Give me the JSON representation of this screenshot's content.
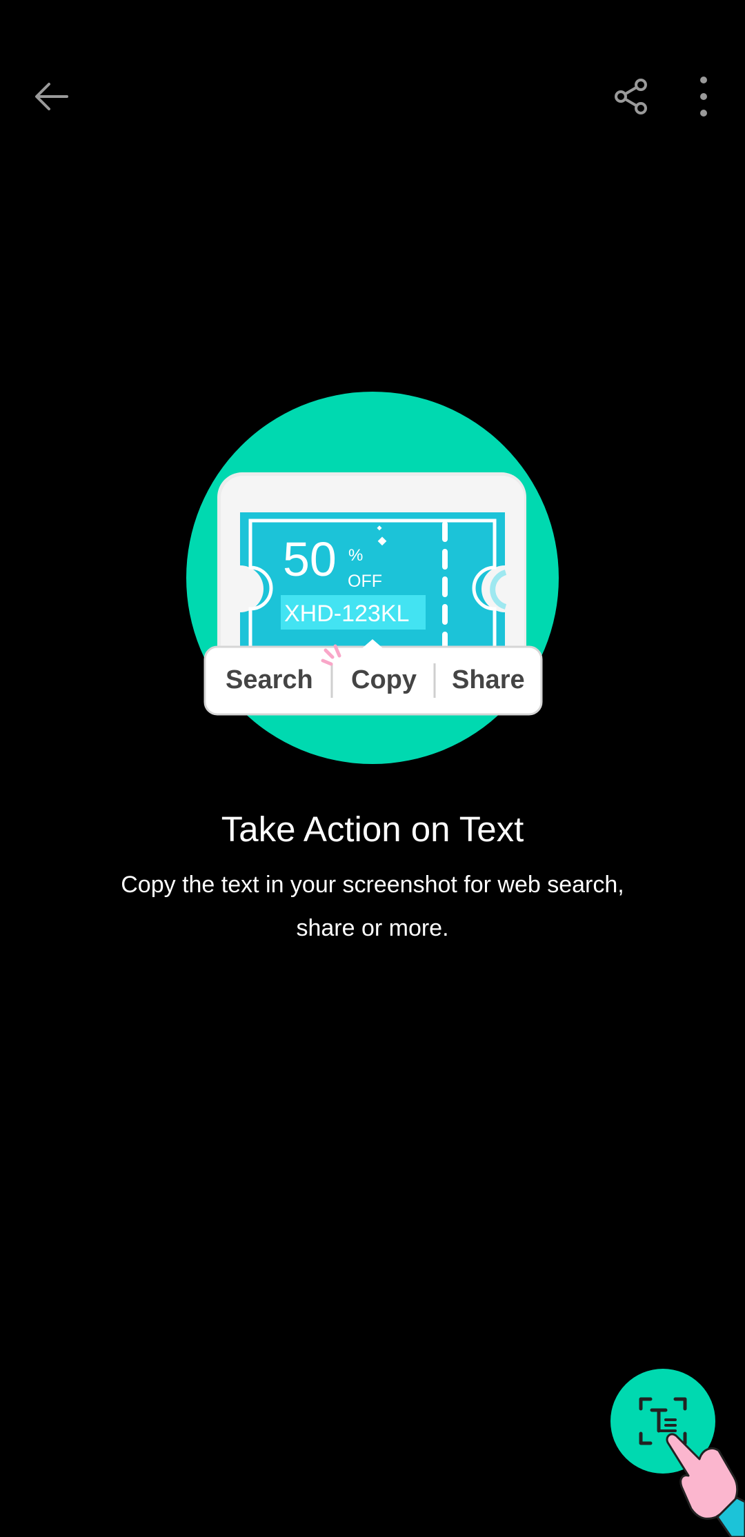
{
  "toolbar": {
    "back_icon": "arrow-left-icon",
    "share_icon": "share-icon",
    "more_icon": "more-vertical-icon"
  },
  "illustration": {
    "coupon_percent": "50",
    "coupon_percent_sign": "%",
    "coupon_off": "OFF",
    "coupon_code": "XHD-123KL",
    "menu_search": "Search",
    "menu_copy": "Copy",
    "menu_share": "Share"
  },
  "content": {
    "title": "Take Action on Text",
    "description": "Copy the text in your screenshot for web search, share or more."
  },
  "fab": {
    "icon": "text-extract-icon"
  },
  "colors": {
    "background": "#000000",
    "accent_green": "#00D9B0",
    "coupon_cyan": "#1CC3D8",
    "hand_pink": "#FBB6CE"
  }
}
